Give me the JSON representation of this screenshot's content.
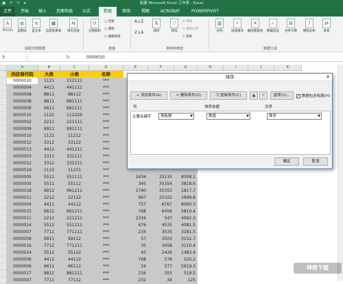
{
  "window": {
    "title": "新建 Microsoft Excel 工作表 - Excel",
    "qat": "▣ ↶ ↷ ▾"
  },
  "tabs": [
    "文件",
    "开始",
    "插入",
    "页面布局",
    "公式",
    "数据",
    "审阅",
    "视图",
    "ACROBAT",
    "POWERPIVOT"
  ],
  "ribbon": {
    "get_external": [
      "Access",
      "自网站",
      "自文本",
      "自其他来源",
      "现有连接"
    ],
    "refresh_all": "全部刷新",
    "connections": [
      "连接",
      "属性",
      "编辑链接"
    ],
    "sort": [
      "排序"
    ],
    "filter": "筛选",
    "filter_small": [
      "清除",
      "重新应用",
      "高级"
    ],
    "tools": [
      "分列",
      "快速填充",
      "删除重复项",
      "数据验证",
      "合并计算",
      "模拟分析",
      "关系"
    ],
    "group_names": [
      "获取外部数据",
      "连接",
      "排序和筛选",
      "数据工具"
    ]
  },
  "formula_bar": {
    "name_box": "3",
    "fx": "fx",
    "value": "0000010"
  },
  "grid": {
    "col_letters": [
      "A",
      "B",
      "C",
      "D",
      "E",
      "F",
      "G",
      "H",
      "I",
      "J",
      "K"
    ],
    "headers": [
      "供应商代码",
      "大类",
      "小类",
      "名称"
    ],
    "rows": [
      [
        "0000010",
        "1121",
        "112111",
        "***",
        "",
        "",
        ""
      ],
      [
        "0000004",
        "4411",
        "441111",
        "***",
        "",
        "",
        ""
      ],
      [
        "0000008",
        "8811",
        "88112",
        "***",
        "",
        "",
        ""
      ],
      [
        "0000008",
        "8811",
        "881111",
        "***",
        "",
        "",
        ""
      ],
      [
        "0000006",
        "6611",
        "661111",
        "***",
        "",
        "",
        ""
      ],
      [
        "0000010",
        "1122",
        "112229",
        "***",
        "",
        "",
        ""
      ],
      [
        "0000002",
        "2211",
        "221111",
        "***",
        "",
        "",
        ""
      ],
      [
        "0000009",
        "9911",
        "991111",
        "***",
        "",
        "",
        ""
      ],
      [
        "0000010",
        "1121",
        "11212",
        "***",
        "",
        "",
        ""
      ],
      [
        "0000012",
        "3312",
        "33122",
        "***",
        "",
        "",
        ""
      ],
      [
        "0000013",
        "4412",
        "441211",
        "***",
        "",
        "",
        ""
      ],
      [
        "0000003",
        "3311",
        "331111",
        "***",
        "",
        "",
        ""
      ],
      [
        "0000012",
        "3312",
        "331211",
        "***",
        "",
        "",
        ""
      ],
      [
        "0000019",
        "1123",
        "11231",
        "***",
        "",
        "",
        ""
      ],
      [
        "0000005",
        "5511",
        "551111",
        "***",
        "2434",
        "25135",
        "8308.1"
      ],
      [
        "0000005",
        "5511",
        "55112",
        "***",
        "345",
        "35354",
        "3818.6"
      ],
      [
        "0000018",
        "9912",
        "991211",
        "***",
        "5790",
        "35353",
        "1817.7"
      ],
      [
        "0000011",
        "2212",
        "22122",
        "***",
        "967",
        "25322",
        "1699.8"
      ],
      [
        "0000004",
        "4411",
        "44112",
        "***",
        "757",
        "6767",
        "8090.3"
      ],
      [
        "0000015",
        "6612",
        "661211",
        "***",
        "768",
        "6456",
        "5810.4"
      ],
      [
        "0000011",
        "2212",
        "221211",
        "***",
        "2334",
        "547",
        "4992.3"
      ],
      [
        "0000014",
        "5512",
        "551211",
        "***",
        "676",
        "4535",
        "4081.5"
      ],
      [
        "0000007",
        "7711",
        "771111",
        "***",
        "234",
        "3535",
        "3181.5"
      ],
      [
        "0000009",
        "9911",
        "99112",
        "***",
        "57",
        "3503",
        "3152.7"
      ],
      [
        "0000016",
        "7712",
        "771211",
        "***",
        "35",
        "3458",
        "3110.4"
      ],
      [
        "0000014",
        "5512",
        "55122",
        "***",
        "43",
        "2426",
        "1483.4"
      ],
      [
        "0000006",
        "4412",
        "44122",
        "***",
        "768",
        "578",
        "520.2"
      ],
      [
        "0000006",
        "6611",
        "66112",
        "***",
        "54",
        "577",
        "5619.3"
      ],
      [
        "0000017",
        "8812",
        "881211",
        "***",
        "234",
        "355",
        "519.5"
      ],
      [
        "0000007",
        "7711",
        "77112",
        "***",
        "232",
        "34",
        "125"
      ]
    ]
  },
  "dialog": {
    "title": "排序",
    "add_level": "添加条件(A)",
    "delete_level": "删除条件(D)",
    "copy_level": "复制条件(C)",
    "options": "选项(O)...",
    "has_header": "数据包含标题(H)",
    "col_header_column": "列",
    "col_header_sortby": "排序依据",
    "col_header_order": "次序",
    "main_key_label": "主要关键字",
    "main_key_value": "销售额",
    "sort_on_value": "数值",
    "order_value": "降序",
    "ok": "确定",
    "cancel": "取消"
  },
  "watermark": "神奇下载"
}
